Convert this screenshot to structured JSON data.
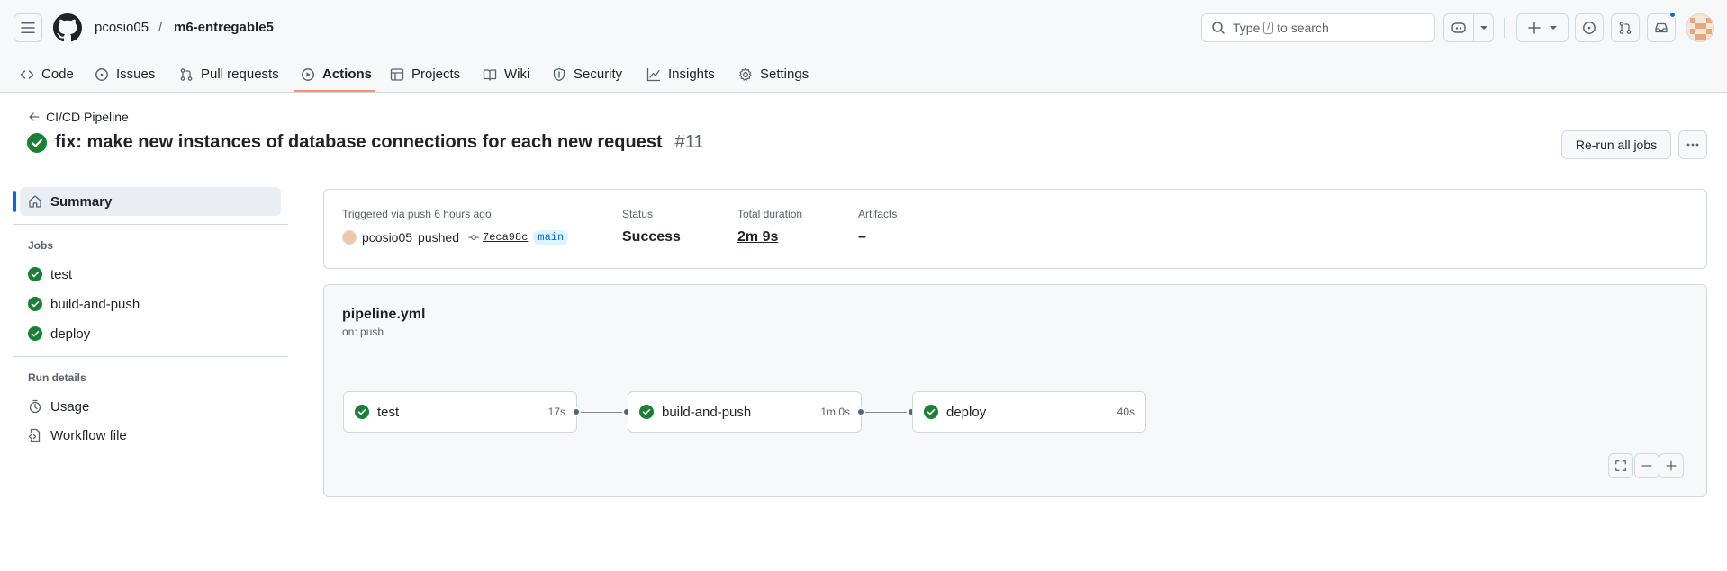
{
  "header": {
    "owner": "pcosio05",
    "separator": "/",
    "repo": "m6-entregable5",
    "search": {
      "prefix": "Type",
      "key": "/",
      "suffix": "to search"
    }
  },
  "tabs": [
    {
      "label": "Code",
      "icon": "code-icon",
      "active": false
    },
    {
      "label": "Issues",
      "icon": "issue-opened-icon",
      "active": false
    },
    {
      "label": "Pull requests",
      "icon": "git-pull-request-icon",
      "active": false
    },
    {
      "label": "Actions",
      "icon": "play-icon",
      "active": true
    },
    {
      "label": "Projects",
      "icon": "table-icon",
      "active": false
    },
    {
      "label": "Wiki",
      "icon": "book-icon",
      "active": false
    },
    {
      "label": "Security",
      "icon": "shield-icon",
      "active": false
    },
    {
      "label": "Insights",
      "icon": "graph-icon",
      "active": false
    },
    {
      "label": "Settings",
      "icon": "gear-icon",
      "active": false
    }
  ],
  "run": {
    "back_label": "CI/CD Pipeline",
    "title": "fix: make new instances of database connections for each new request",
    "number": "#11",
    "rerun_label": "Re-run all jobs"
  },
  "sidebar": {
    "summary_label": "Summary",
    "jobs_heading": "Jobs",
    "jobs": [
      {
        "label": "test",
        "status": "success"
      },
      {
        "label": "build-and-push",
        "status": "success"
      },
      {
        "label": "deploy",
        "status": "success"
      }
    ],
    "details_heading": "Run details",
    "details": [
      {
        "label": "Usage",
        "icon": "stopwatch-icon"
      },
      {
        "label": "Workflow file",
        "icon": "file-code-icon"
      }
    ]
  },
  "summary": {
    "trigger_label": "Triggered via push 6 hours ago",
    "actor": "pcosio05",
    "action": "pushed",
    "commit": "7eca98c",
    "branch": "main",
    "status_label": "Status",
    "status_value": "Success",
    "duration_label": "Total duration",
    "duration_value": "2m 9s",
    "artifacts_label": "Artifacts",
    "artifacts_value": "–"
  },
  "workflow": {
    "file": "pipeline.yml",
    "trigger": "on: push",
    "jobs": [
      {
        "name": "test",
        "duration": "17s"
      },
      {
        "name": "build-and-push",
        "duration": "1m 0s"
      },
      {
        "name": "deploy",
        "duration": "40s"
      }
    ]
  },
  "colors": {
    "success": "#1a7f37",
    "accent": "#0969da",
    "tab_underline": "#fd8c73"
  }
}
